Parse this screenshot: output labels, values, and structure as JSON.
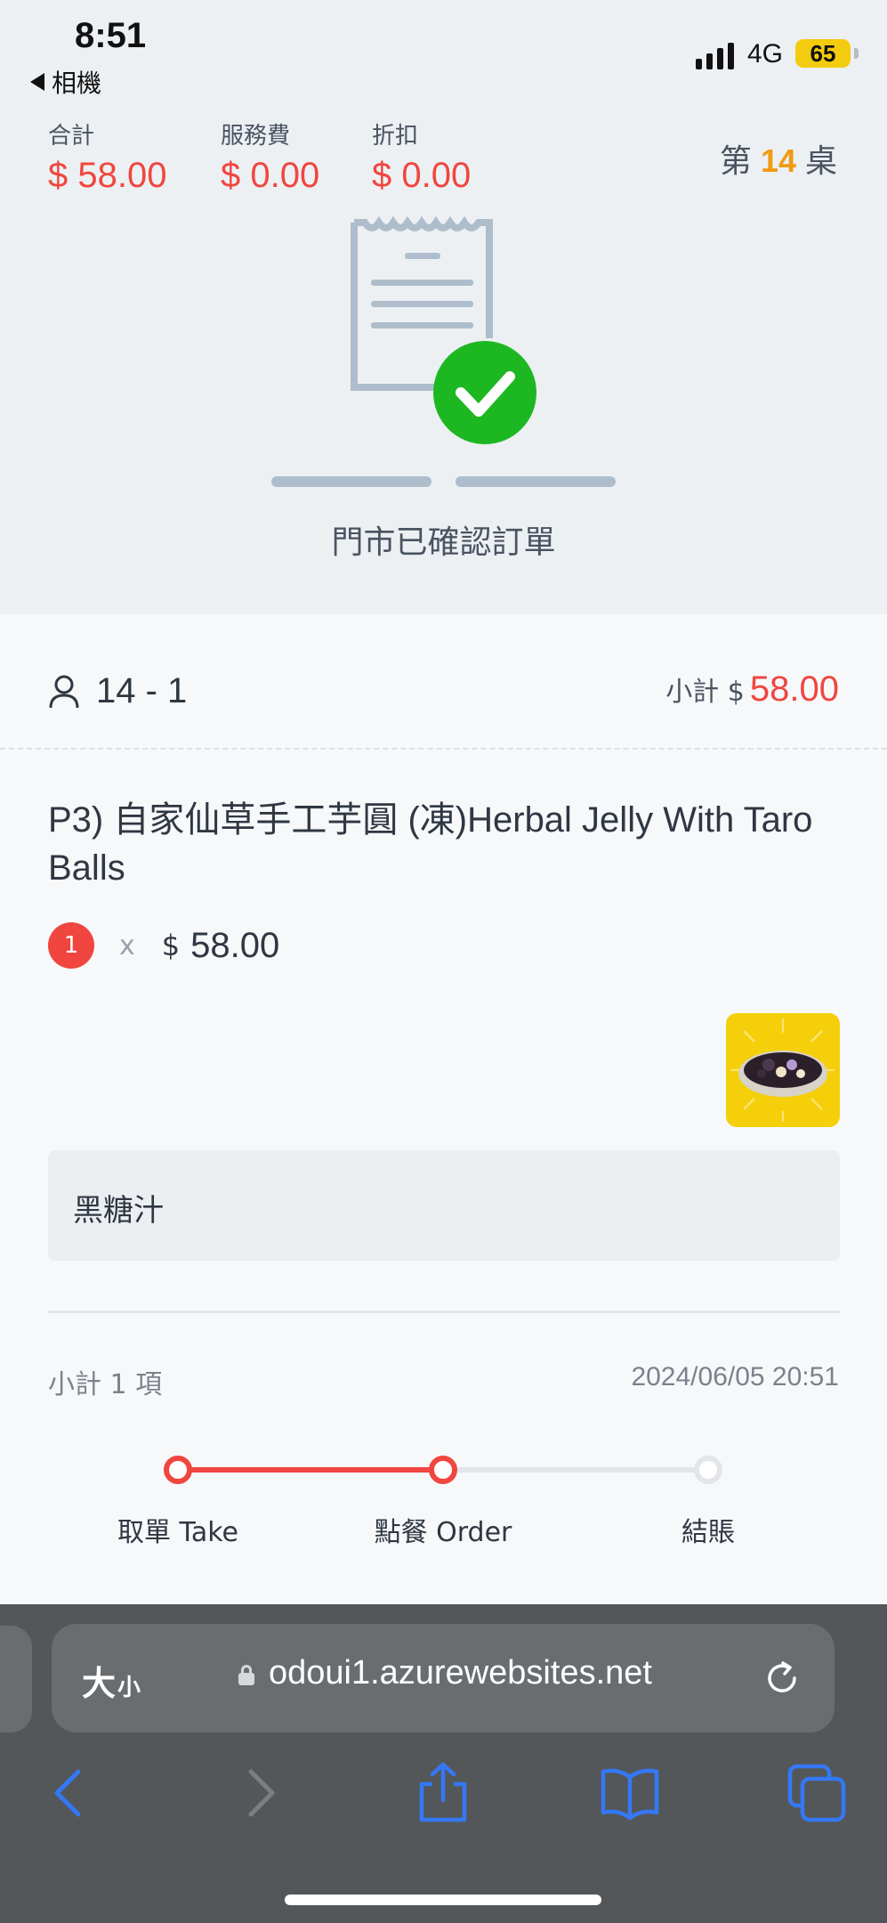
{
  "status_bar": {
    "time": "8:51",
    "back_app": "相機",
    "network": "4G",
    "battery": "65"
  },
  "summary": {
    "total_label": "合計",
    "total_value": "$ 58.00",
    "service_label": "服務費",
    "service_value": "$ 0.00",
    "discount_label": "折扣",
    "discount_value": "$ 0.00",
    "table_prefix": "第",
    "table_number": "14",
    "table_suffix": "桌"
  },
  "confirmation": {
    "message": "門市已確認訂單"
  },
  "order": {
    "guest": "14 - 1",
    "subtotal_label": "小計 $",
    "subtotal_value": "58.00",
    "item": {
      "name": "P3) 自家仙草手工芋圓 (凍)Herbal Jelly With Taro Balls",
      "quantity": "1",
      "times": "x",
      "currency": "$",
      "price": "58.00",
      "note": "黑糖汁"
    },
    "footer_count": "小計 1 項",
    "footer_time": "2024/06/05 20:51"
  },
  "progress": {
    "steps": [
      {
        "label": "取單 Take",
        "state": "done"
      },
      {
        "label": "點餐 Order",
        "state": "current"
      },
      {
        "label": "結賬",
        "state": "pending"
      }
    ]
  },
  "browser": {
    "text_size_big": "大",
    "text_size_small": "小",
    "url": "odoui1.azurewebsites.net"
  },
  "colors": {
    "accent_red": "#f0463f",
    "table_orange": "#f19a12",
    "check_green": "#1db821",
    "ios_blue": "#3478f6"
  }
}
